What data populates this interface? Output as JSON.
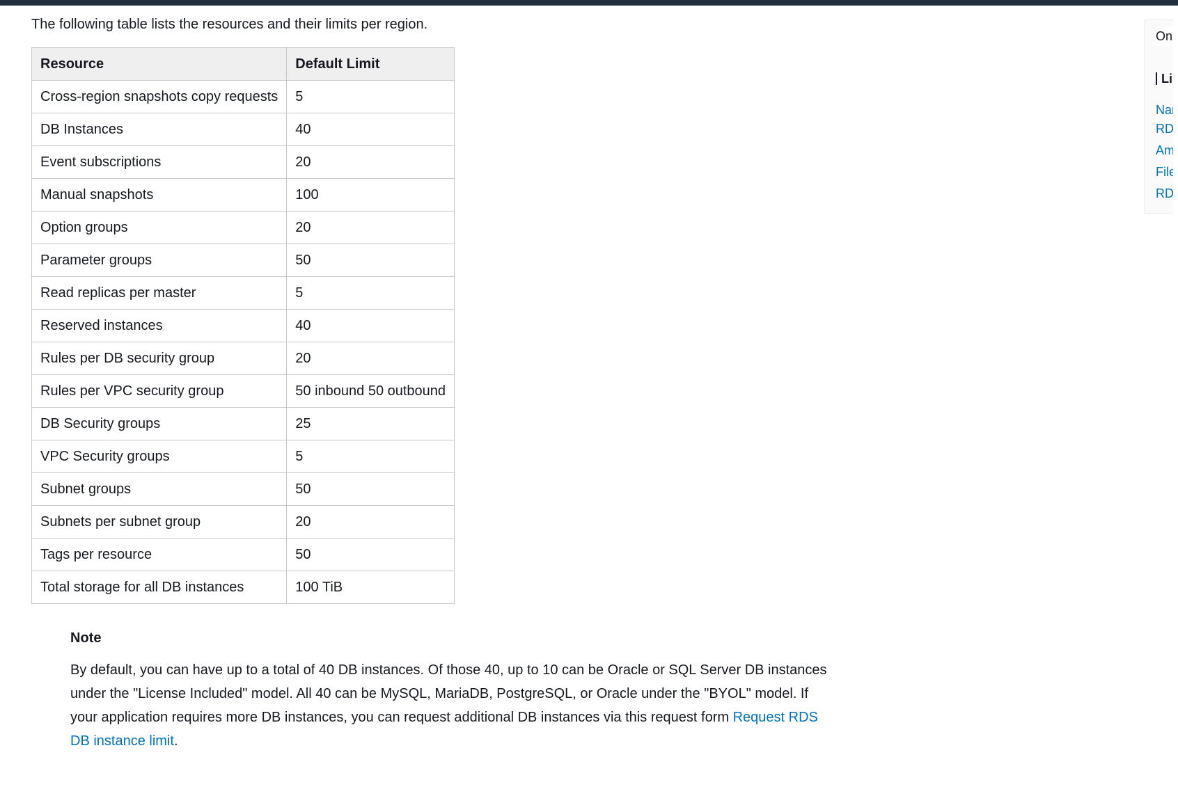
{
  "intro": "The following table lists the resources and their limits per region.",
  "table": {
    "headers": {
      "resource": "Resource",
      "limit": "Default Limit"
    },
    "rows": [
      {
        "resource": "Cross-region snapshots copy requests",
        "limit": "5"
      },
      {
        "resource": "DB Instances",
        "limit": "40"
      },
      {
        "resource": "Event subscriptions",
        "limit": "20"
      },
      {
        "resource": "Manual snapshots",
        "limit": "100"
      },
      {
        "resource": "Option groups",
        "limit": "20"
      },
      {
        "resource": "Parameter groups",
        "limit": "50"
      },
      {
        "resource": "Read replicas per master",
        "limit": "5"
      },
      {
        "resource": "Reserved instances",
        "limit": "40"
      },
      {
        "resource": "Rules per DB security group",
        "limit": "20"
      },
      {
        "resource": "Rules per VPC security group",
        "limit": "50 inbound 50 outbound"
      },
      {
        "resource": "DB Security groups",
        "limit": "25"
      },
      {
        "resource": "VPC Security groups",
        "limit": "5"
      },
      {
        "resource": "Subnet groups",
        "limit": "50"
      },
      {
        "resource": "Subnets per subnet group",
        "limit": "20"
      },
      {
        "resource": "Tags per resource",
        "limit": "50"
      },
      {
        "resource": "Total storage for all DB instances",
        "limit": "100 TiB"
      }
    ]
  },
  "note": {
    "title": "Note",
    "body_prefix": "By default, you can have up to a total of 40 DB instances. Of those 40, up to 10 can be Oracle or SQL Server DB instances under the \"License Included\" model. All 40 can be MySQL, MariaDB, PostgreSQL, or Oracle under the \"BYOL\" model. If your application requires more DB instances, you can request additional DB instances via this request form ",
    "link_text": "Request RDS DB instance limit",
    "body_suffix": "."
  },
  "side": {
    "heading": "On this page:",
    "strong": "Limits in Amazon RDS",
    "l1": "Naming Constraints in Amazon RDS",
    "l2": "Amazon RDS",
    "l3": "File Size Limits in Amazon RDS",
    "l4": "RDS"
  }
}
